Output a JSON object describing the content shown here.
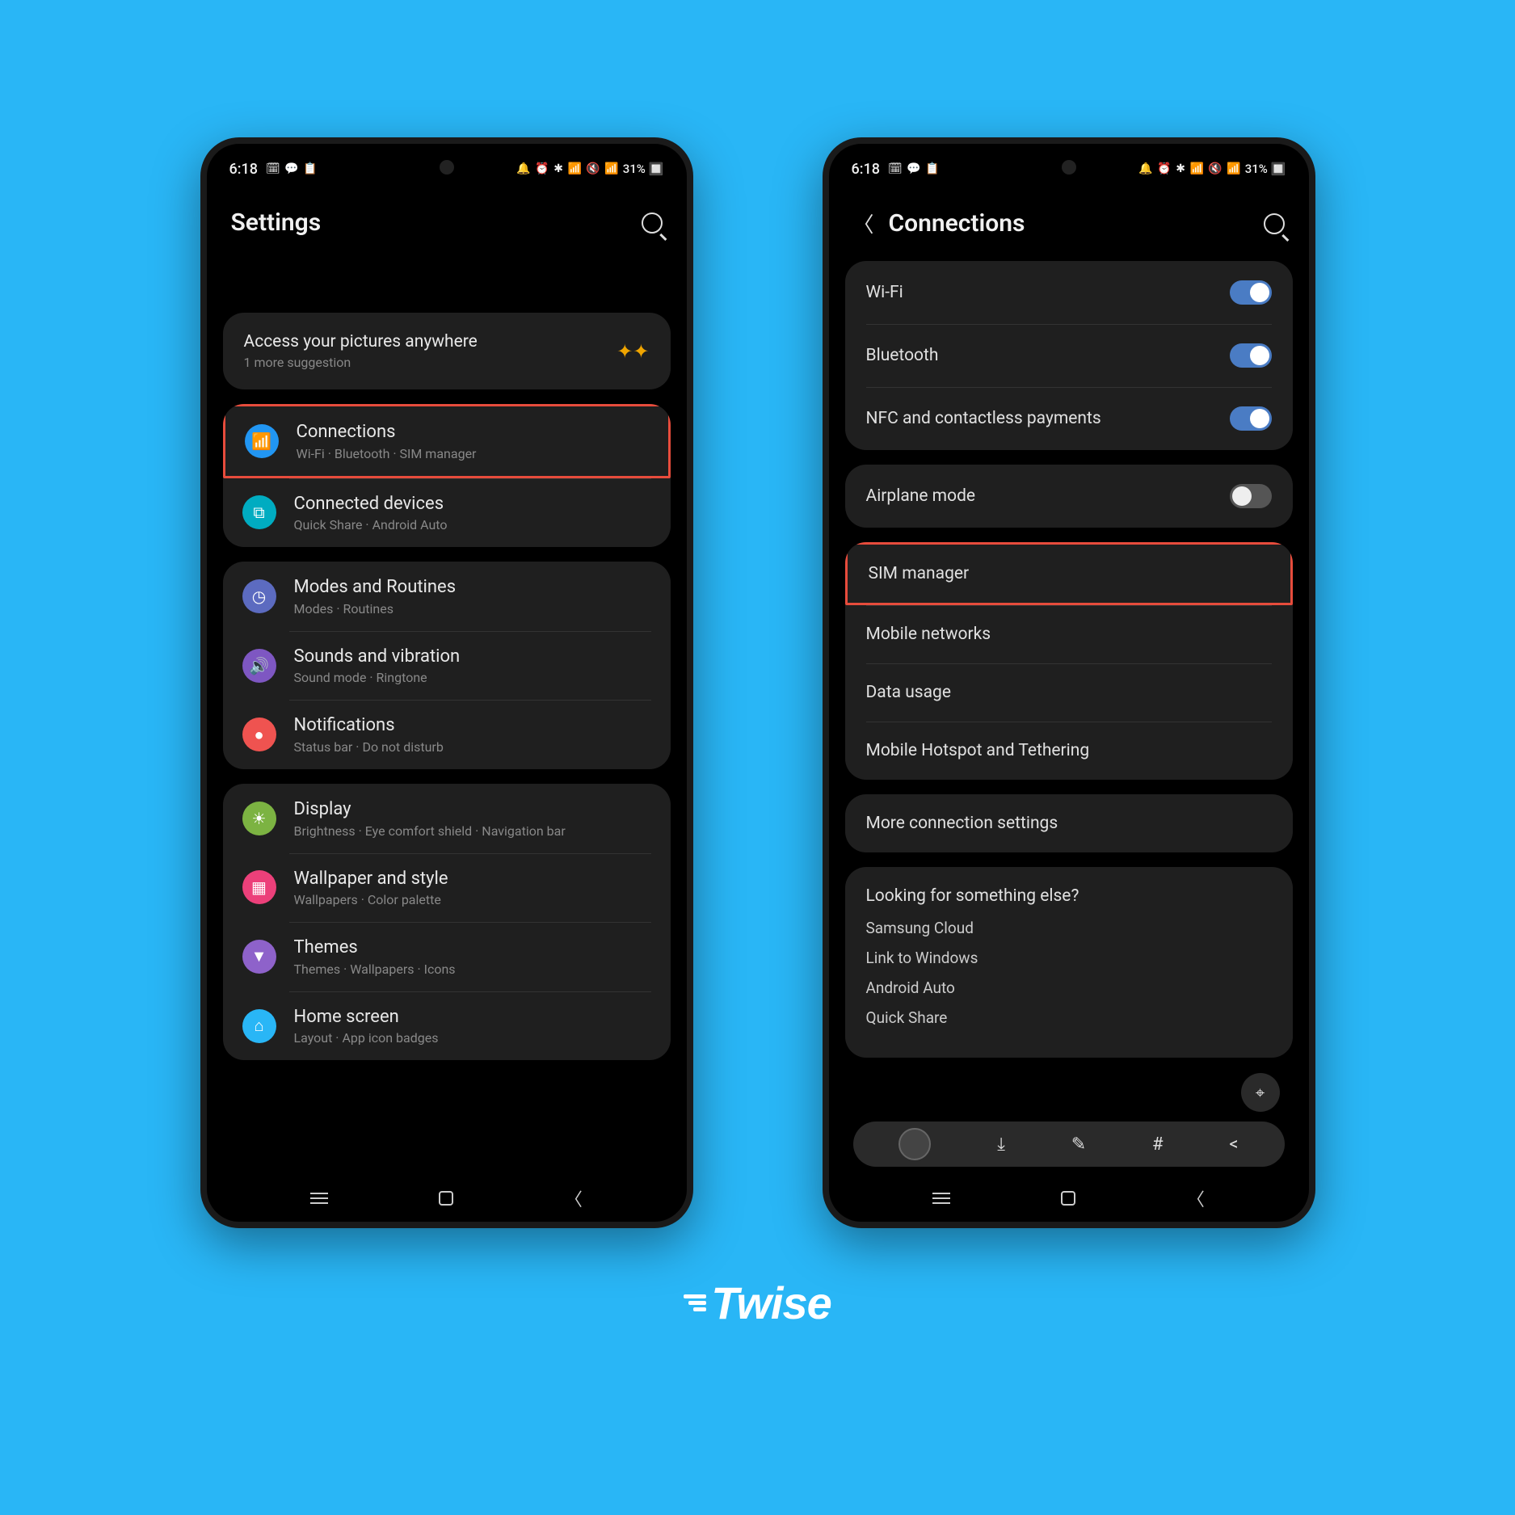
{
  "status": {
    "time": "6:18",
    "left_icons": "🗓 💬 📋",
    "right_icons": "🔔 ⏰ ✱ 📶 🔇 📶 ",
    "battery": "31%"
  },
  "phone1": {
    "header_title": "Settings",
    "suggestion": {
      "title": "Access your pictures anywhere",
      "sub": "1 more suggestion"
    },
    "groups": [
      [
        {
          "title": "Connections",
          "sub": "Wi-Fi · Bluetooth · SIM manager",
          "icon": "wifi",
          "color": "ic-blue",
          "hl": true
        },
        {
          "title": "Connected devices",
          "sub": "Quick Share · Android Auto",
          "icon": "devices",
          "color": "ic-teal"
        }
      ],
      [
        {
          "title": "Modes and Routines",
          "sub": "Modes · Routines",
          "icon": "routines",
          "color": "ic-indigo"
        },
        {
          "title": "Sounds and vibration",
          "sub": "Sound mode · Ringtone",
          "icon": "sound",
          "color": "ic-purple"
        },
        {
          "title": "Notifications",
          "sub": "Status bar · Do not disturb",
          "icon": "notif",
          "color": "ic-red"
        }
      ],
      [
        {
          "title": "Display",
          "sub": "Brightness · Eye comfort shield · Navigation bar",
          "icon": "display",
          "color": "ic-green"
        },
        {
          "title": "Wallpaper and style",
          "sub": "Wallpapers · Color palette",
          "icon": "wallpaper",
          "color": "ic-pink"
        },
        {
          "title": "Themes",
          "sub": "Themes · Wallpapers · Icons",
          "icon": "themes",
          "color": "ic-pur2"
        },
        {
          "title": "Home screen",
          "sub": "Layout · App icon badges",
          "icon": "home",
          "color": "ic-cyan"
        }
      ]
    ]
  },
  "phone2": {
    "header_title": "Connections",
    "groups": [
      [
        {
          "title": "Wi-Fi",
          "toggle": true
        },
        {
          "title": "Bluetooth",
          "toggle": true
        },
        {
          "title": "NFC and contactless payments",
          "toggle": true
        }
      ],
      [
        {
          "title": "Airplane mode",
          "toggle": false
        }
      ],
      [
        {
          "title": "SIM manager",
          "hl": true
        },
        {
          "title": "Mobile networks"
        },
        {
          "title": "Data usage"
        },
        {
          "title": "Mobile Hotspot and Tethering"
        }
      ],
      [
        {
          "title": "More connection settings"
        }
      ]
    ],
    "footer": {
      "title": "Looking for something else?",
      "links": [
        "Samsung Cloud",
        "Link to Windows",
        "Android Auto",
        "Quick Share"
      ]
    }
  },
  "logo_text": "Twise"
}
